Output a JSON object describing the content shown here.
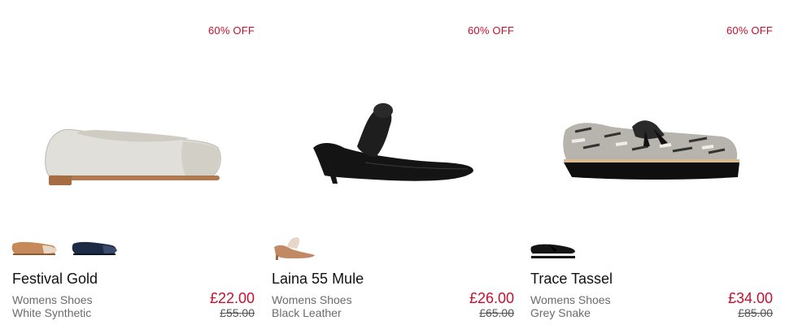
{
  "products": [
    {
      "badge": "60% OFF",
      "image_icon": "ballet-flat-shoe-image",
      "swatches": [
        "tan-flat-swatch",
        "navy-flat-swatch"
      ],
      "name": "Festival Gold",
      "category": "Womens Shoes",
      "material": "White Synthetic",
      "price": "£22.00",
      "was_price": "£55.00"
    },
    {
      "badge": "60% OFF",
      "image_icon": "mule-heel-shoe-image",
      "swatches": [
        "tan-mule-swatch"
      ],
      "name": "Laina 55 Mule",
      "category": "Womens Shoes",
      "material": "Black Leather",
      "price": "£26.00",
      "was_price": "£65.00"
    },
    {
      "badge": "60% OFF",
      "image_icon": "tassel-loafer-shoe-image",
      "swatches": [
        "black-loafer-swatch"
      ],
      "name": "Trace Tassel",
      "category": "Womens Shoes",
      "material": "Grey Snake",
      "price": "£34.00",
      "was_price": "£85.00"
    }
  ],
  "colors": {
    "sale_red": "#c8102e",
    "text_grey": "#6b6b6b"
  }
}
